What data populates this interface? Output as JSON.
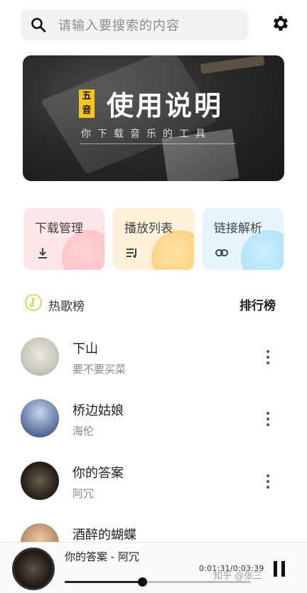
{
  "search": {
    "placeholder": "请输入要搜索的内容"
  },
  "banner": {
    "badge_line1": "五",
    "badge_line2": "音",
    "title": "使用说明",
    "subtitle": "你下载音乐的工具"
  },
  "features": [
    {
      "label": "下载管理",
      "icon": "download-icon"
    },
    {
      "label": "播放列表",
      "icon": "playlist-icon"
    },
    {
      "label": "链接解析",
      "icon": "link-icon"
    }
  ],
  "section": {
    "hot_label": "热歌榜",
    "rank_label": "排行榜"
  },
  "songs": [
    {
      "name": "下山",
      "artist": "要不要买菜"
    },
    {
      "name": "桥边姑娘",
      "artist": "海伦"
    },
    {
      "name": "你的答案",
      "artist": "阿冗"
    },
    {
      "name": "酒醉的蝴蝶",
      "artist": ""
    }
  ],
  "player": {
    "title": "你的答案 - 阿冗",
    "time": "0:01:31/0:03:39",
    "progress": 0.415
  },
  "watermark": "知乎 @张三",
  "colors": {
    "accent_yellow": "#f5c518",
    "card_pink": "#fde6e8",
    "card_orange": "#fff1d8",
    "card_blue": "#e6f4fb"
  }
}
